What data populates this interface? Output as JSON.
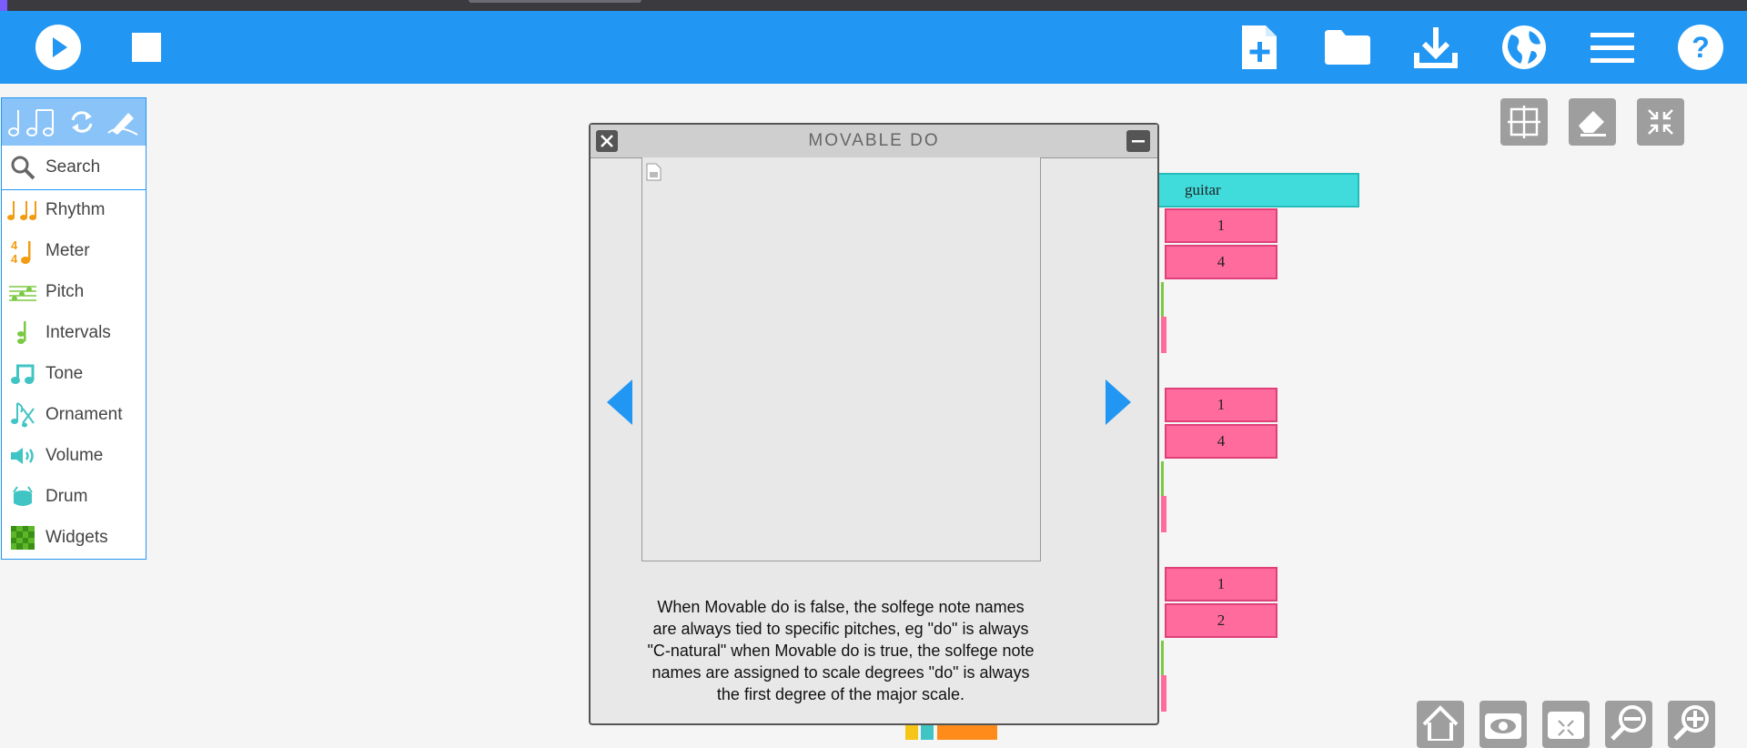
{
  "toolbar": {
    "left_buttons": [
      "play-icon",
      "stop-icon"
    ],
    "right_buttons": [
      "new-project-icon",
      "open-folder-icon",
      "save-download-icon",
      "language-globe-icon",
      "menu-icon",
      "help-icon"
    ],
    "color": "#2196f3"
  },
  "palette": {
    "search_label": "Search",
    "items": [
      {
        "label": "Rhythm",
        "icon": "rhythm-icon",
        "color": "#f39c12"
      },
      {
        "label": "Meter",
        "icon": "meter-icon",
        "color": "#f39c12"
      },
      {
        "label": "Pitch",
        "icon": "pitch-icon",
        "color": "#7ac943"
      },
      {
        "label": "Intervals",
        "icon": "intervals-icon",
        "color": "#7ac943"
      },
      {
        "label": "Tone",
        "icon": "tone-icon",
        "color": "#40c4c4"
      },
      {
        "label": "Ornament",
        "icon": "ornament-icon",
        "color": "#40c4c4"
      },
      {
        "label": "Volume",
        "icon": "volume-icon",
        "color": "#40c4c4"
      },
      {
        "label": "Drum",
        "icon": "drum-icon",
        "color": "#40c4c4"
      },
      {
        "label": "Widgets",
        "icon": "widgets-icon",
        "color": "#5cb82a"
      }
    ]
  },
  "dialog": {
    "title": "MOVABLE DO",
    "description": "When Movable do is false, the solfege note names are always tied to specific pitches, eg \"do\" is always \"C-natural\" when Movable do is true, the solfege note names are assigned to scale degrees \"do\" is always the first degree of the major scale."
  },
  "blocks": {
    "instrument": "guitar",
    "values": [
      "1",
      "4",
      "1",
      "4",
      "1",
      "2"
    ]
  }
}
